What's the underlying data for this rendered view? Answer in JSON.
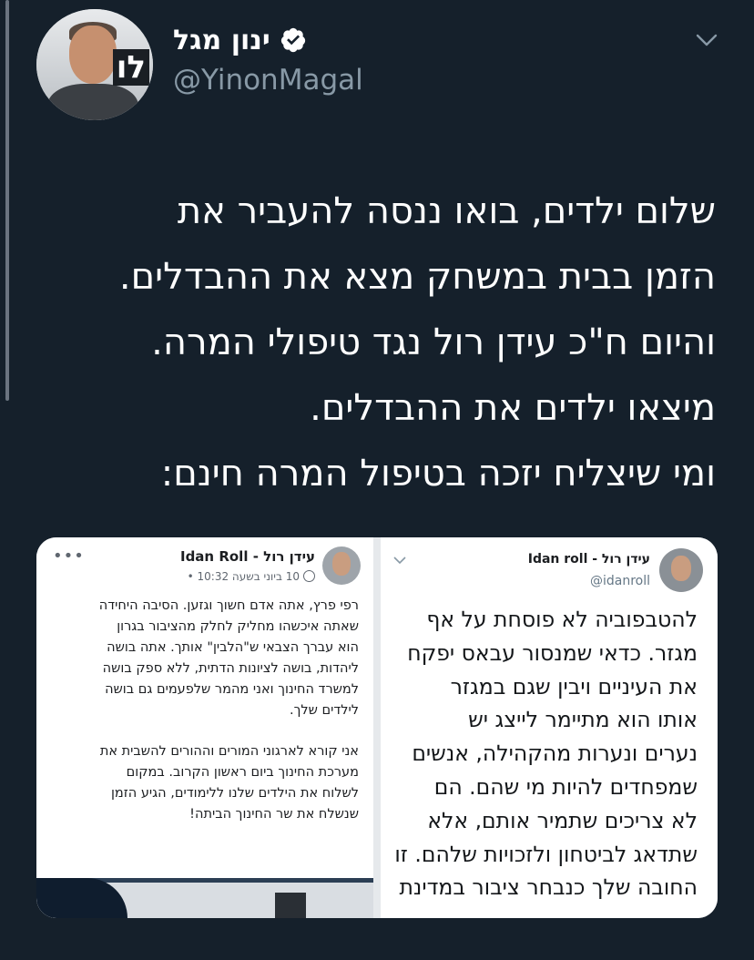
{
  "author": {
    "display_name": "ינון מגל",
    "handle": "@YinonMagal",
    "avatar_logo_text": "לו",
    "verified": true
  },
  "tweet": {
    "lines": [
      "שלום ילדים, בואו ננסה להעביר את",
      "הזמן בבית במשחק מצא את ההבדלים.",
      "והיום ח\"כ עידן רול נגד טיפולי המרה.",
      "מיצאו ילדים את ההבדלים.",
      "ומי שיצליח יזכה בטיפול המרה חינם:"
    ]
  },
  "media": {
    "facebook_post": {
      "author_name": "עידן רול - Idan Roll",
      "timestamp": "10 ביוני בשעה 10:32 •",
      "menu_dots": "•••",
      "paragraph_1": [
        "רפי פרץ, אתה אדם חשוך וגזען. הסיבה היחידה",
        "שאתה איכשהו מחליק לחלק מהציבור בגרון",
        "הוא עברך הצבאי ש\"הלבין\" אותך. אתה בושה",
        "ליהדות, בושה לציונות הדתית, ללא ספק בושה",
        "למשרד החינוך ואני מהמר שלפעמים גם בושה",
        "לילדים שלך."
      ],
      "paragraph_2": [
        "אני קורא לארגוני המורים וההורים להשבית את",
        "מערכת החינוך ביום ראשון הקרוב. במקום",
        "לשלוח את הילדים שלנו ללימודים, הגיע הזמן",
        "שנשלח את שר החינוך הביתה!"
      ]
    },
    "twitter_post": {
      "author_name": "עידן רול - Idan roll",
      "handle": "@idanroll",
      "lines": [
        "להטבפוביה לא פוסחת על אף",
        "מגזר. כדאי שמנסור עבאס יפקח",
        "את העיניים ויבין שגם במגזר",
        "אותו הוא מתיימר לייצג יש",
        "נערים ונערות מהקהילה, אנשים",
        "שמפחדים להיות מי שהם. הם",
        "לא צריכים שתמיר אותם, אלא",
        "שתדאג לביטחון ולזכויות שלהם. זו",
        "החובה שלך כנבחר ציבור במדינת"
      ]
    }
  }
}
